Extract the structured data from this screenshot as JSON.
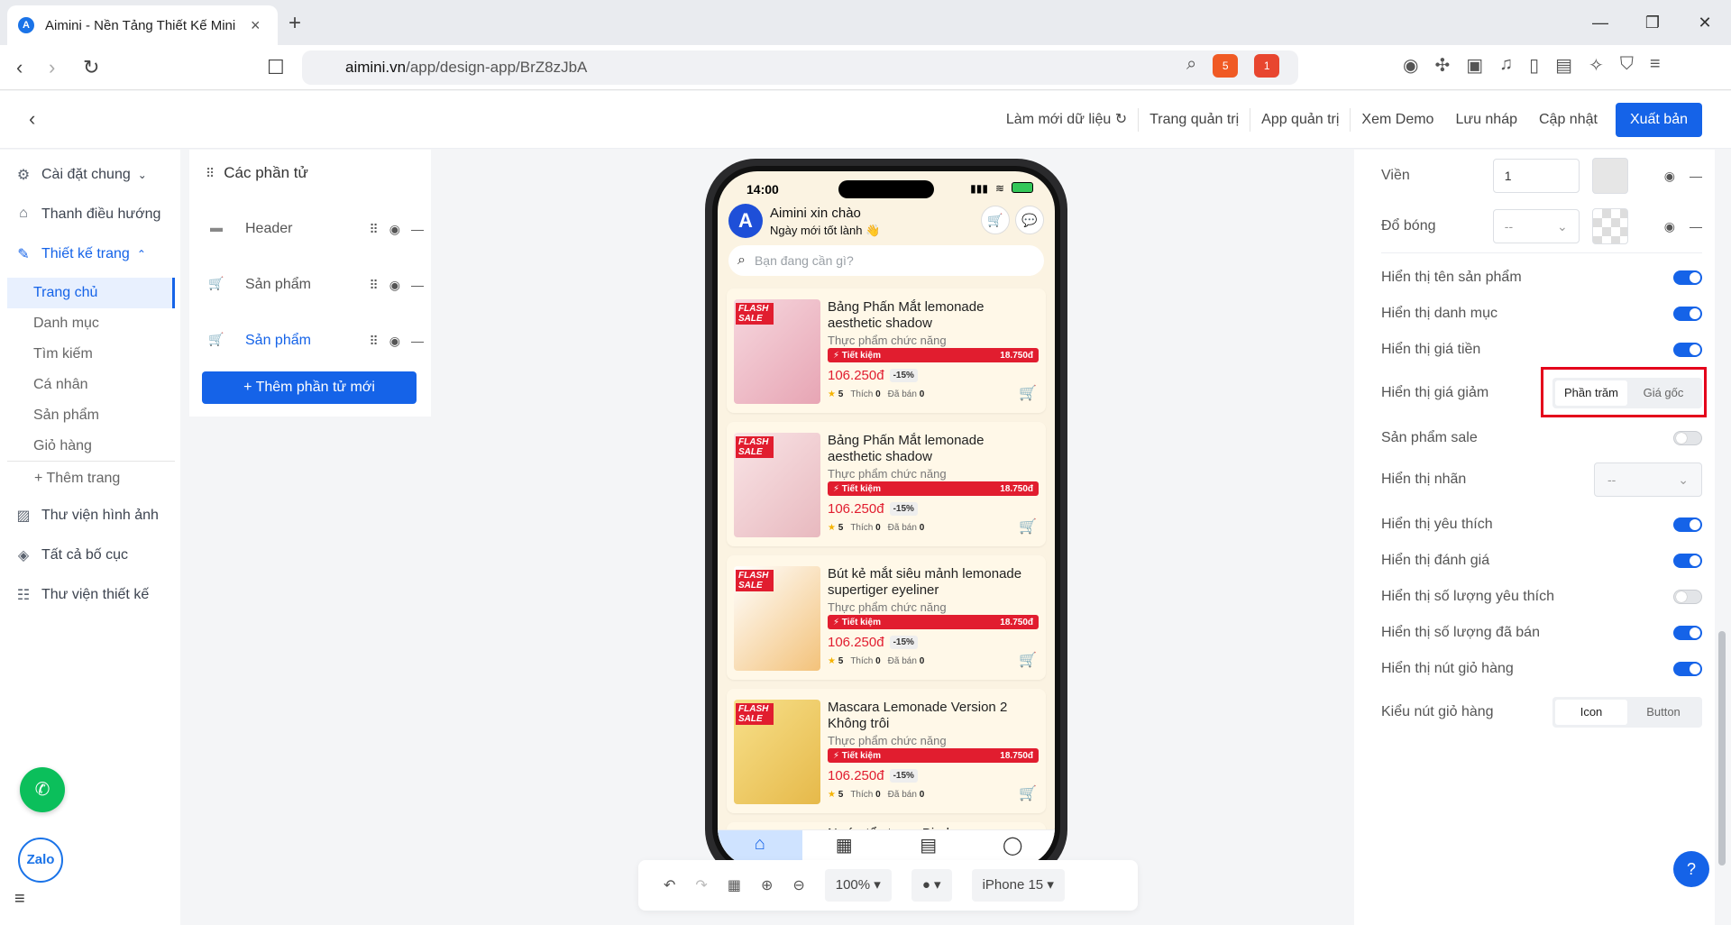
{
  "browser": {
    "tab_title": "Aimini - Nền Tảng Thiết Kế Mini",
    "favicon": "A",
    "url_host": "aimini.vn",
    "url_path": "/app/design-app/BrZ8zJbA",
    "brave_badge": "5",
    "alert_badge": "1"
  },
  "topbar": {
    "refresh_data": "Làm mới dữ liệu",
    "admin_page": "Trang quản trị",
    "admin_app": "App quản trị",
    "view_demo": "Xem Demo",
    "save_draft": "Lưu nháp",
    "update": "Cập nhật",
    "publish": "Xuất bản"
  },
  "sidebar": {
    "general_settings": "Cài đặt chung",
    "navigation_bar": "Thanh điều hướng",
    "page_design": "Thiết kế trang",
    "pages": [
      "Trang chủ",
      "Danh mục",
      "Tìm kiếm",
      "Cá nhân",
      "Sản phẩm",
      "Giỏ hàng"
    ],
    "add_page": "+ Thêm trang",
    "image_library": "Thư viện hình ảnh",
    "all_layouts": "Tất cả bố cục",
    "design_library": "Thư viện thiết kế"
  },
  "elements_panel": {
    "title": "Các phần tử",
    "items": [
      "Header",
      "Sản phẩm",
      "Sản phẩm"
    ],
    "add_button": "+ Thêm phần tử mới"
  },
  "phone": {
    "time": "14:00",
    "greeting": "Aimini xin chào",
    "subgreeting": "Ngày mới tốt lành 👋",
    "logo": "A",
    "search_placeholder": "Bạn đang cần gì?",
    "flash_sale": "FLASH SALE",
    "products": [
      {
        "name": "Bảng Phấn Mắt lemonade aesthetic shadow",
        "category": "Thực phẩm chức năng",
        "save_label": "⚡ Tiết kiệm",
        "save_amount": "18.750đ",
        "price": "106.250đ",
        "discount": "-15%",
        "rating": "5",
        "likes_label": "Thích",
        "likes": "0",
        "sold_label": "Đã bán",
        "sold": "0"
      },
      {
        "name": "Bảng Phấn Mắt lemonade aesthetic shadow",
        "category": "Thực phẩm chức năng",
        "save_label": "⚡ Tiết kiệm",
        "save_amount": "18.750đ",
        "price": "106.250đ",
        "discount": "-15%",
        "rating": "5",
        "likes_label": "Thích",
        "likes": "0",
        "sold_label": "Đã bán",
        "sold": "0"
      },
      {
        "name": "Bút kẻ mắt siêu mảnh lemonade supertiger eyeliner",
        "category": "Thực phẩm chức năng",
        "save_label": "⚡ Tiết kiệm",
        "save_amount": "18.750đ",
        "price": "106.250đ",
        "discount": "-15%",
        "rating": "5",
        "likes_label": "Thích",
        "likes": "0",
        "sold_label": "Đã bán",
        "sold": "0"
      },
      {
        "name": "Mascara Lemonade Version 2 Không trôi",
        "category": "Thực phẩm chức năng",
        "save_label": "⚡ Tiết kiệm",
        "save_amount": "18.750đ",
        "price": "106.250đ",
        "discount": "-15%",
        "rating": "5",
        "likes_label": "Thích",
        "likes": "0",
        "sold_label": "Đã bán",
        "sold": "0"
      }
    ],
    "partial_product": "Nước tẩy trang Bioderma"
  },
  "canvas_toolbar": {
    "zoom": "100%",
    "device": "iPhone 15"
  },
  "right_panel": {
    "border_label": "Viền",
    "border_value": "1",
    "shadow_label": "Đổ bóng",
    "shadow_value": "--",
    "show_name": "Hiển thị tên sản phẩm",
    "show_category": "Hiển thị danh mục",
    "show_price": "Hiển thị giá tiền",
    "show_discount": "Hiển thị giá giảm",
    "discount_percent": "Phần trăm",
    "discount_original": "Giá gốc",
    "sale_product": "Sản phẩm sale",
    "show_label": "Hiển thị nhãn",
    "label_value": "--",
    "show_favorite": "Hiển thị yêu thích",
    "show_rating": "Hiển thị đánh giá",
    "show_favorite_count": "Hiển thị số lượng yêu thích",
    "show_sold_count": "Hiển thị số lượng đã bán",
    "show_cart_button": "Hiển thị nút giỏ hàng",
    "cart_button_style": "Kiểu nút giỏ hàng",
    "style_icon": "Icon",
    "style_button": "Button"
  },
  "floating": {
    "zalo": "Zalo",
    "help": "?"
  },
  "colors": {
    "accent": "#1563e8",
    "sale_red": "#e11d2f",
    "highlight": "#e4001b"
  }
}
